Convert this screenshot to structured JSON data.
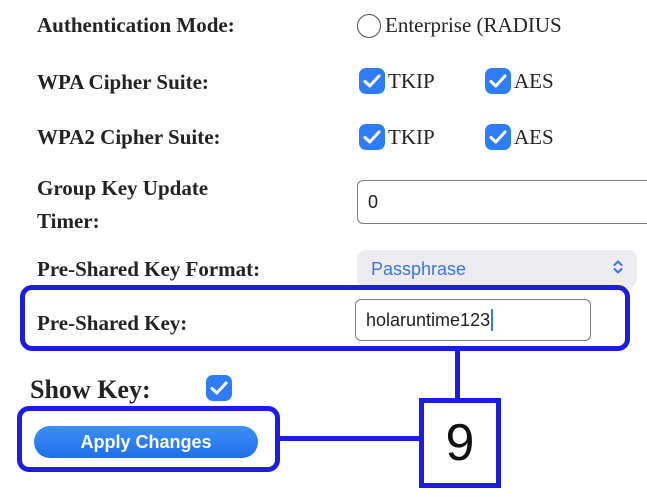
{
  "form": {
    "auth_mode": {
      "label": "Authentication Mode:",
      "option": "Enterprise (RADIUS"
    },
    "wpa_cipher": {
      "label": "WPA Cipher Suite:",
      "tkip": "TKIP",
      "aes": "AES"
    },
    "wpa2_cipher": {
      "label": "WPA2 Cipher Suite:",
      "tkip": "TKIP",
      "aes": "AES"
    },
    "group_key": {
      "label_line1": "Group Key Update",
      "label_line2": "Timer:",
      "value": "0"
    },
    "psk_format": {
      "label": "Pre-Shared Key Format:",
      "value": "Passphrase"
    },
    "psk": {
      "label": "Pre-Shared Key:",
      "value": "holaruntime123"
    },
    "show_key": {
      "label": "Show Key:"
    },
    "apply_label": "Apply Changes"
  },
  "annotation": {
    "step_number": "9"
  },
  "colors": {
    "accent": "#2e7cf6",
    "annotation": "#1d1de0",
    "select_text": "#3b76d6"
  }
}
